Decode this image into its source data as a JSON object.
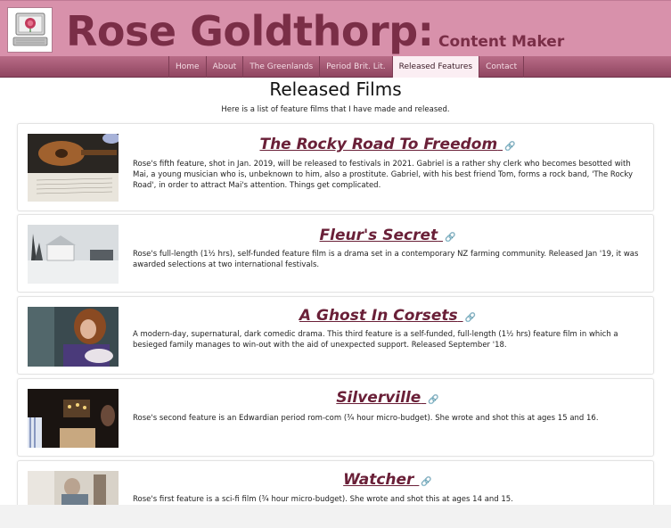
{
  "header": {
    "site_title": "Rose Goldthorp:",
    "site_subtitle": "Content Maker"
  },
  "nav": {
    "items": [
      {
        "label": "Home"
      },
      {
        "label": "About"
      },
      {
        "label": "The Greenlands"
      },
      {
        "label": "Period Brit. Lit."
      },
      {
        "label": "Released Features"
      },
      {
        "label": "Contact"
      }
    ],
    "active": "Released Features"
  },
  "main": {
    "title": "Released Films",
    "intro": "Here is a list of feature films that I have made and released."
  },
  "films": [
    {
      "title": "The Rocky Road To Freedom",
      "description": "Rose's fifth feature, shot in Jan. 2019, will be released to festivals in 2021. Gabriel is a rather shy clerk who becomes besotted with Mai, a young musician who is, unbeknown to him, also a prostitute. Gabriel, with his best friend Tom, forms a rock band, 'The Rocky Road', in order to attract Mai's attention. Things get complicated."
    },
    {
      "title": "Fleur's Secret",
      "description": "Rose's full-length (1½ hrs), self-funded feature film  is a drama set in a contemporary NZ farming community. Released Jan '19, it was awarded selections at two international festivals."
    },
    {
      "title": "A Ghost In Corsets",
      "description": "A modern-day, supernatural, dark comedic drama. This third feature is a self-funded, full-length (1½ hrs) feature film  in which a besieged family manages to win-out with the aid of unexpected support. Released September '18."
    },
    {
      "title": "Silverville",
      "description": "Rose's second feature is an Edwardian period rom-com (¾ hour micro-budget). She wrote and shot this at ages 15 and 16."
    },
    {
      "title": "Watcher",
      "description": "Rose's first feature is a sci-fi film (¾ hour micro-budget). She wrote and shot this at ages 14 and 15."
    }
  ]
}
